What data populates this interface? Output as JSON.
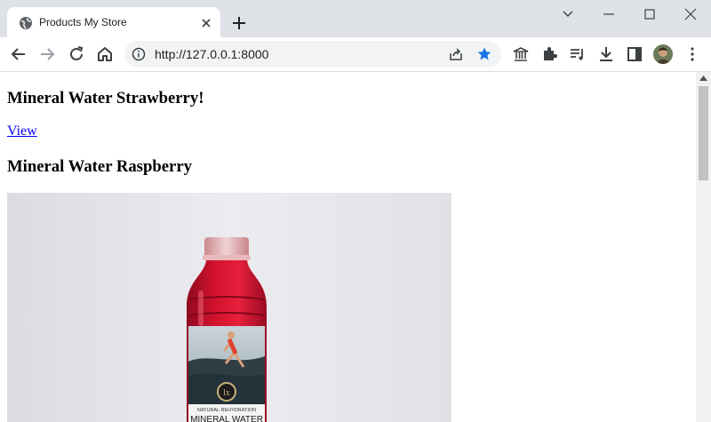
{
  "tab": {
    "title": "Products My Store"
  },
  "address": {
    "url": "http://127.0.0.1:8000"
  },
  "products": [
    {
      "name": "Mineral Water Strawberry!",
      "link_label": "View"
    },
    {
      "name": "Mineral Water Raspberry"
    }
  ],
  "product_image": {
    "label_line": "NATURAL REHYDRATION",
    "label_title": "MINERAL WATER"
  },
  "colors": {
    "tabstrip": "#dee1e6",
    "link": "#0000ee",
    "star": "#1a73e8",
    "bottle": "#c8102e"
  }
}
